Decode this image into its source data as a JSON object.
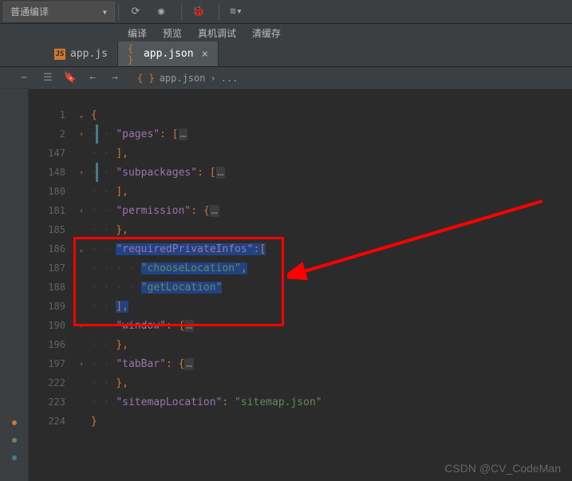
{
  "toolbar": {
    "compile_mode": "普通编译",
    "labels": {
      "compile": "编译",
      "preview": "预览",
      "debug": "真机调试",
      "clear": "清缓存"
    }
  },
  "tabs": [
    {
      "name": "app.js",
      "active": false
    },
    {
      "name": "app.json",
      "active": true
    }
  ],
  "breadcrumb": {
    "file": "app.json",
    "rest": "..."
  },
  "lines": [
    {
      "num": "1",
      "fold": "v",
      "indent": 0,
      "tokens": [
        [
          "brace",
          "{"
        ]
      ]
    },
    {
      "num": "2",
      "fold": ">",
      "indent": 1,
      "tokens": [
        [
          "key",
          "\"pages\""
        ],
        [
          "colon",
          ": "
        ],
        [
          "punct",
          "["
        ],
        [
          "ellipsis",
          "…"
        ]
      ],
      "bar": true
    },
    {
      "num": "147",
      "fold": "",
      "indent": 1,
      "tokens": [
        [
          "punct",
          "]"
        ],
        [
          "punct",
          ","
        ]
      ]
    },
    {
      "num": "148",
      "fold": ">",
      "indent": 1,
      "tokens": [
        [
          "key",
          "\"subpackages\""
        ],
        [
          "colon",
          ": "
        ],
        [
          "punct",
          "["
        ],
        [
          "ellipsis",
          "…"
        ]
      ],
      "bar": true
    },
    {
      "num": "180",
      "fold": "",
      "indent": 1,
      "tokens": [
        [
          "punct",
          "]"
        ],
        [
          "punct",
          ","
        ]
      ]
    },
    {
      "num": "181",
      "fold": ">",
      "indent": 1,
      "tokens": [
        [
          "key",
          "\"permission\""
        ],
        [
          "colon",
          ": "
        ],
        [
          "brace",
          "{"
        ],
        [
          "ellipsis",
          "…"
        ]
      ]
    },
    {
      "num": "185",
      "fold": "",
      "indent": 1,
      "tokens": [
        [
          "punct",
          "}"
        ],
        [
          "punct",
          ","
        ]
      ]
    },
    {
      "num": "186",
      "fold": "v",
      "indent": 1,
      "tokens": [
        [
          "key",
          "\"requiredPrivateInfos\""
        ],
        [
          "colon",
          ":"
        ],
        [
          "punct",
          "["
        ]
      ],
      "hl": true
    },
    {
      "num": "187",
      "fold": "",
      "indent": 2,
      "tokens": [
        [
          "string",
          "\"chooseLocation\""
        ],
        [
          "punct",
          ","
        ]
      ],
      "hl": true
    },
    {
      "num": "188",
      "fold": "",
      "indent": 2,
      "tokens": [
        [
          "string",
          "\"getLocation\""
        ]
      ],
      "hl": true
    },
    {
      "num": "189",
      "fold": "",
      "indent": 1,
      "tokens": [
        [
          "punct",
          "]"
        ],
        [
          "punct",
          ","
        ]
      ],
      "hl": true
    },
    {
      "num": "190",
      "fold": ">",
      "indent": 1,
      "tokens": [
        [
          "key",
          "\"window\""
        ],
        [
          "colon",
          ": "
        ],
        [
          "brace",
          "{"
        ],
        [
          "ellipsis",
          "…"
        ]
      ]
    },
    {
      "num": "196",
      "fold": "",
      "indent": 1,
      "tokens": [
        [
          "punct",
          "}"
        ],
        [
          "punct",
          ","
        ]
      ]
    },
    {
      "num": "197",
      "fold": ">",
      "indent": 1,
      "tokens": [
        [
          "key",
          "\"tabBar\""
        ],
        [
          "colon",
          ": "
        ],
        [
          "brace",
          "{"
        ],
        [
          "ellipsis",
          "…"
        ]
      ]
    },
    {
      "num": "222",
      "fold": "",
      "indent": 1,
      "tokens": [
        [
          "punct",
          "}"
        ],
        [
          "punct",
          ","
        ]
      ]
    },
    {
      "num": "223",
      "fold": "",
      "indent": 1,
      "tokens": [
        [
          "key",
          "\"sitemapLocation\""
        ],
        [
          "colon",
          ": "
        ],
        [
          "string",
          "\"sitemap.json\""
        ]
      ]
    },
    {
      "num": "224",
      "fold": "",
      "indent": 0,
      "tokens": [
        [
          "brace",
          "}"
        ]
      ]
    }
  ],
  "watermark": "CSDN @CV_CodeMan"
}
